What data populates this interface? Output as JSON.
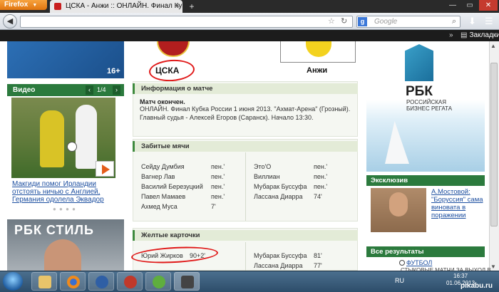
{
  "browser": {
    "menu_button": "Firefox",
    "tab_title": "ЦСКА - Анжи :: ОНЛАЙН. Финал Кубка",
    "search_placeholder": "Google",
    "bookmarks_label": "Закладки"
  },
  "left": {
    "age_badge": "16+",
    "video_title": "Видео",
    "video_pager": "1/4",
    "video_caption": "Макгиди помог Ирландии отстоять ничью с Англией, Германия одолела Эквадор",
    "ad_text": "РБК СТИЛЬ"
  },
  "match": {
    "home_team": "ЦСКА",
    "away_team": "Анжи",
    "info_header": "Информация о матче",
    "result": "Матч окончен.",
    "info_text": "ОНЛАЙН. Финал Кубка России 1 июня 2013. \"Ахмат-Арена\" (Грозный). Главный судья - Алексей Егоров (Саранск). Начало 13:30."
  },
  "goals": {
    "header": "Забитые мячи",
    "home": [
      {
        "player": "Сейду Думбия",
        "time": "пен.'"
      },
      {
        "player": "Вагнер Лав",
        "time": "пен.'"
      },
      {
        "player": "Василий Березуцкий",
        "time": "пен.'"
      },
      {
        "player": "Павел Мамаев",
        "time": "пен.'"
      },
      {
        "player": "Ахмед Муса",
        "time": "7'"
      }
    ],
    "away": [
      {
        "player": "Это'О",
        "time": "пен.'"
      },
      {
        "player": "Виллиан",
        "time": "пен.'"
      },
      {
        "player": "Мубарак Буссуфа",
        "time": "пен.'"
      },
      {
        "player": "Лассана Диарра",
        "time": "74'"
      }
    ]
  },
  "cards": {
    "header": "Желтые карточки",
    "home": [
      {
        "player": "Юрий Жирков",
        "time": "90+2'"
      }
    ],
    "away": [
      {
        "player": "Мубарак Буссуфа",
        "time": "81'"
      },
      {
        "player": "Лассана Диарра",
        "time": "77'"
      }
    ]
  },
  "right": {
    "ad_brand": "РБК",
    "ad_sub": "РОССИЙСКАЯ БИЗНЕС РЕГАТА",
    "exclusive_header": "Эксклюзив",
    "exclusive_text": "А.Мостовой: \"Боруссия\" сама виновата в поражении",
    "results_header": "Все результаты",
    "football_link": "ФУТБОЛ",
    "matches_text": "СТЫКОВЫЕ МАТЧИ ЗА ВЫХОД В"
  },
  "taskbar": {
    "lang": "RU",
    "time": "16:37",
    "date": "01.06.2013",
    "watermark": "pikabu.ru"
  },
  "colors": {
    "green": "#2b7a3d",
    "annotation_red": "#e01818",
    "firefox_orange": "#e1750f"
  }
}
